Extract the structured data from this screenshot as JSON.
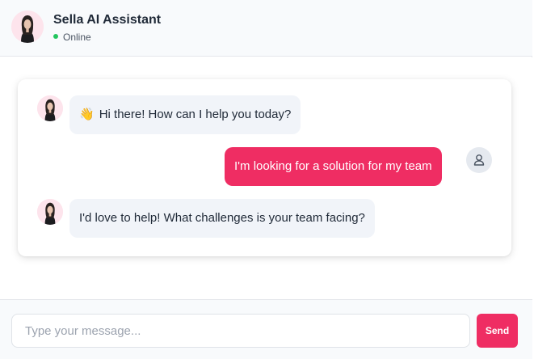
{
  "header": {
    "title": "Sella AI Assistant",
    "status": "Online",
    "status_color": "#22c55e"
  },
  "messages": [
    {
      "sender": "bot",
      "emoji": "👋",
      "text": "Hi there! How can I help you today?"
    },
    {
      "sender": "user",
      "text": "I'm looking for a solution for my team"
    },
    {
      "sender": "bot",
      "text": "I'd love to help! What challenges is your team facing?"
    }
  ],
  "composer": {
    "placeholder": "Type your message...",
    "value": "",
    "send_label": "Send"
  },
  "colors": {
    "accent": "#ef2d63",
    "bot_bubble": "#f1f4f9",
    "header_bg": "#f8fafc"
  },
  "icons": {
    "bot_avatar": "woman-portrait-avatar",
    "user_avatar": "person-icon"
  }
}
